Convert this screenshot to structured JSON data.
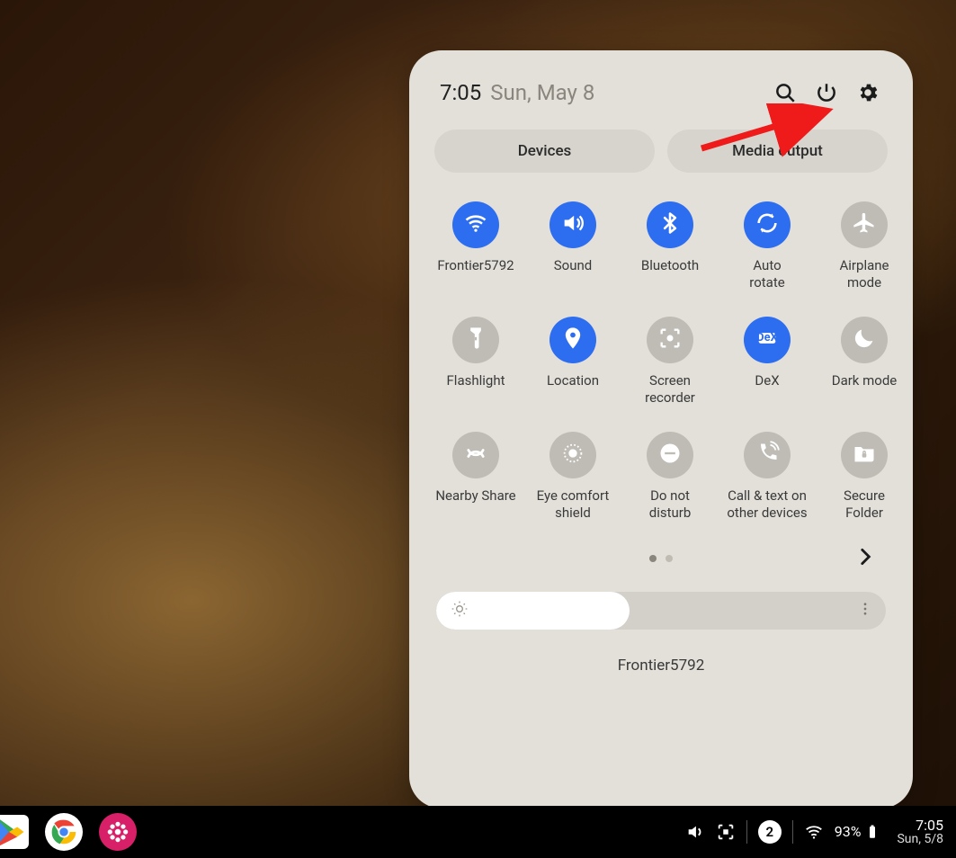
{
  "header": {
    "time": "7:05",
    "date": "Sun, May 8"
  },
  "pills": {
    "devices": "Devices",
    "media_output": "Media output"
  },
  "tiles": [
    {
      "id": "wifi",
      "label": "Frontier5792",
      "active": true
    },
    {
      "id": "sound",
      "label": "Sound",
      "active": true
    },
    {
      "id": "bluetooth",
      "label": "Bluetooth",
      "active": true
    },
    {
      "id": "autorotate",
      "label": "Auto\nrotate",
      "active": true
    },
    {
      "id": "airplane",
      "label": "Airplane\nmode",
      "active": false
    },
    {
      "id": "flashlight",
      "label": "Flashlight",
      "active": false
    },
    {
      "id": "location",
      "label": "Location",
      "active": true
    },
    {
      "id": "screenrec",
      "label": "Screen\nrecorder",
      "active": false
    },
    {
      "id": "dex",
      "label": "DeX",
      "active": true
    },
    {
      "id": "darkmode",
      "label": "Dark mode",
      "active": false
    },
    {
      "id": "nearbyshare",
      "label": "Nearby Share",
      "active": false
    },
    {
      "id": "eyecomfort",
      "label": "Eye comfort\nshield",
      "active": false
    },
    {
      "id": "dnd",
      "label": "Do not\ndisturb",
      "active": false
    },
    {
      "id": "calltext",
      "label": "Call & text on\nother devices",
      "active": false
    },
    {
      "id": "securefolder",
      "label": "Secure\nFolder",
      "active": false
    }
  ],
  "pager": {
    "pages": 2,
    "current": 0
  },
  "brightness": {
    "percent": 43
  },
  "network_footer": "Frontier5792",
  "taskbar": {
    "apps": [
      "play-store",
      "chrome",
      "gallery"
    ],
    "notification_count": "2",
    "battery_percent": "93%",
    "time": "7:05",
    "date": "Sun, 5/8"
  },
  "colors": {
    "accent": "#2d6ef0",
    "tile_off": "#bfbcb5",
    "panel_bg": "#e3e0d9",
    "annotation": "#ef1a1a"
  }
}
